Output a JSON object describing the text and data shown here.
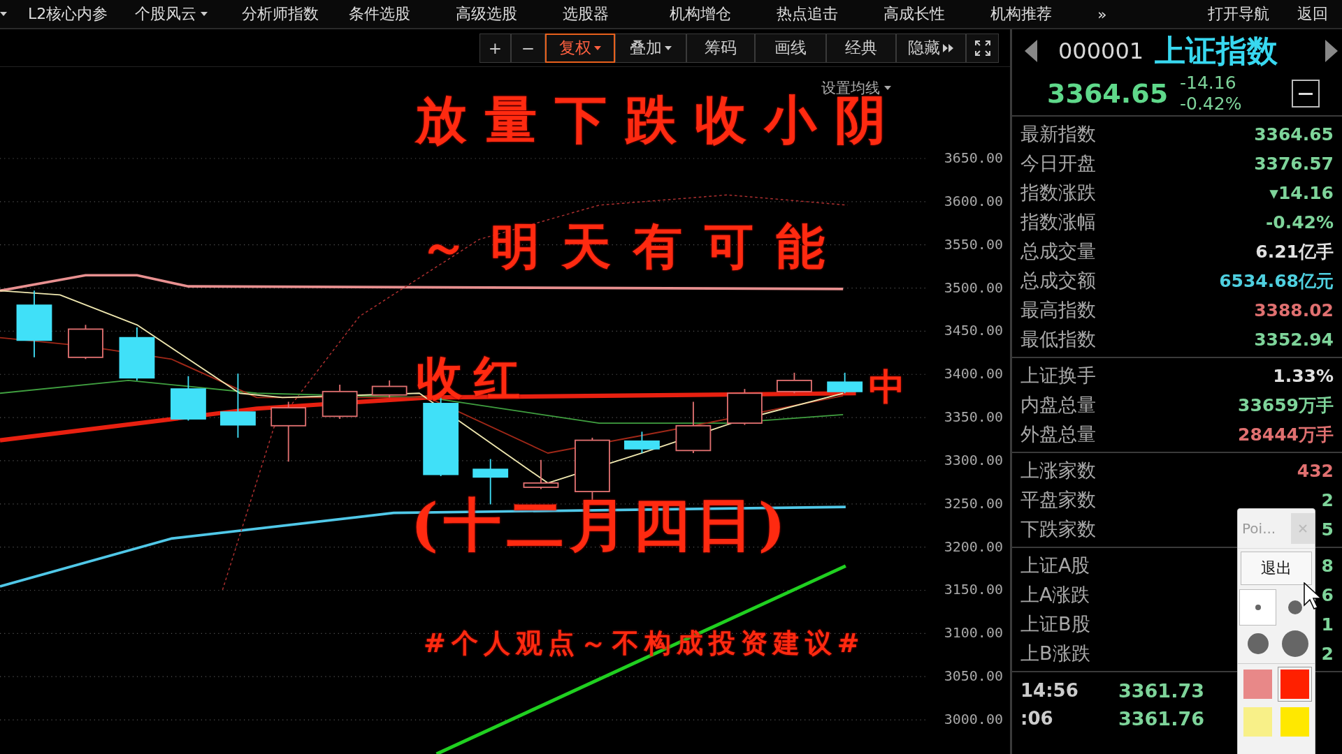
{
  "menu": {
    "items": [
      {
        "kind": "caret"
      },
      {
        "kind": "text",
        "label": "L2核心内参",
        "dropdown": false
      },
      {
        "kind": "text",
        "label": "个股风云",
        "dropdown": true
      },
      {
        "kind": "text",
        "label": "分析师指数",
        "dropdown": false
      },
      {
        "kind": "text",
        "label": "条件选股",
        "dropdown": false
      },
      {
        "kind": "text",
        "label": "高级选股",
        "dropdown": false
      },
      {
        "kind": "text",
        "label": "选股器",
        "dropdown": false
      },
      {
        "kind": "text",
        "label": "机构增仓",
        "dropdown": false
      },
      {
        "kind": "text",
        "label": "热点追击",
        "dropdown": false
      },
      {
        "kind": "text",
        "label": "高成长性",
        "dropdown": false
      },
      {
        "kind": "text",
        "label": "机构推荐",
        "dropdown": false
      },
      {
        "kind": "text",
        "label": "»",
        "dropdown": false
      }
    ],
    "right": [
      "打开导航",
      "返回"
    ]
  },
  "toolbar": [
    {
      "kind": "text",
      "label": "+",
      "selected": false,
      "dropdown": false
    },
    {
      "kind": "text",
      "label": "−",
      "selected": false,
      "dropdown": false
    },
    {
      "kind": "text",
      "label": "复权",
      "selected": true,
      "dropdown": true
    },
    {
      "kind": "text",
      "label": "叠加",
      "selected": false,
      "dropdown": true
    },
    {
      "kind": "text",
      "label": "筹码",
      "selected": false,
      "dropdown": false
    },
    {
      "kind": "text",
      "label": "画线",
      "selected": false,
      "dropdown": false
    },
    {
      "kind": "text",
      "label": "经典",
      "selected": false,
      "dropdown": false
    },
    {
      "kind": "text",
      "label": "隐藏",
      "selected": false,
      "dropdown": false,
      "more": true
    },
    {
      "kind": "fullscreen"
    }
  ],
  "chart": {
    "ma_setting": "设置均线",
    "price_axis": [
      "3650.00",
      "3600.00",
      "3550.00",
      "3500.00",
      "3450.00",
      "3400.00",
      "3350.00",
      "3300.00",
      "3250.00",
      "3200.00",
      "3150.00",
      "3100.00",
      "3050.00",
      "3000.00"
    ],
    "annotations": [
      {
        "text": "放量下跌收小阴"
      },
      {
        "text": "～明天有可能"
      },
      {
        "text": "收红"
      },
      {
        "text": "中"
      },
      {
        "text": "(十二月四日)"
      },
      {
        "text": "#个人观点～不构成投资建议#"
      }
    ]
  },
  "quote": {
    "code": "000001",
    "name": "上证指数",
    "price": "3364.65",
    "change": "-14.16",
    "change_pct": "-0.42%",
    "groups": [
      [
        {
          "label": "最新指数",
          "value": "3364.65",
          "color": "#7ed49a"
        },
        {
          "label": "今日开盘",
          "value": "3376.57",
          "color": "#7ed49a"
        },
        {
          "label": "指数涨跌",
          "value": "▾14.16",
          "color": "#7ed49a"
        },
        {
          "label": "指数涨幅",
          "value": "-0.42%",
          "color": "#7ed49a"
        },
        {
          "label": "总成交量",
          "value": "6.21亿手",
          "color": "#e0e0e0"
        },
        {
          "label": "总成交额",
          "value": "6534.68亿元",
          "color": "#4fd0e0"
        },
        {
          "label": "最高指数",
          "value": "3388.02",
          "color": "#e07070"
        },
        {
          "label": "最低指数",
          "value": "3352.94",
          "color": "#7ed49a"
        }
      ],
      [
        {
          "label": "上证换手",
          "value": "1.33%",
          "color": "#e0e0e0"
        },
        {
          "label": "内盘总量",
          "value": "33659万手",
          "color": "#7ed49a"
        },
        {
          "label": "外盘总量",
          "value": "28444万手",
          "color": "#e07070"
        }
      ],
      [
        {
          "label": "上涨家数",
          "value": "432",
          "color": "#e07070"
        },
        {
          "label": "平盘家数",
          "value": "2",
          "color": "#7ed49a"
        },
        {
          "label": "下跌家数",
          "value": "5",
          "color": "#7ed49a"
        }
      ],
      [
        {
          "label": "上证A股",
          "value": "8",
          "color": "#7ed49a"
        },
        {
          "label": "上A涨跌",
          "value": "6",
          "color": "#7ed49a"
        },
        {
          "label": "上证B股",
          "value": "1",
          "color": "#7ed49a"
        },
        {
          "label": "上B涨跌",
          "value": "2",
          "color": "#7ed49a"
        }
      ]
    ],
    "ticks": [
      {
        "time": "14:56",
        "value": "3361.73"
      },
      {
        "time": ":06",
        "value": "3361.76"
      }
    ]
  },
  "pen_popup": {
    "title": "Poi...",
    "exit": "退出",
    "sizes": [
      {
        "selected": true
      },
      {
        "selected": false
      },
      {
        "selected": false
      },
      {
        "selected": false
      }
    ],
    "colors": [
      {
        "color": "#e88888",
        "selected": false
      },
      {
        "color": "#ff2000",
        "selected": true
      },
      {
        "color": "#f8f088",
        "selected": false
      },
      {
        "color": "#ffe800",
        "selected": false
      }
    ]
  }
}
